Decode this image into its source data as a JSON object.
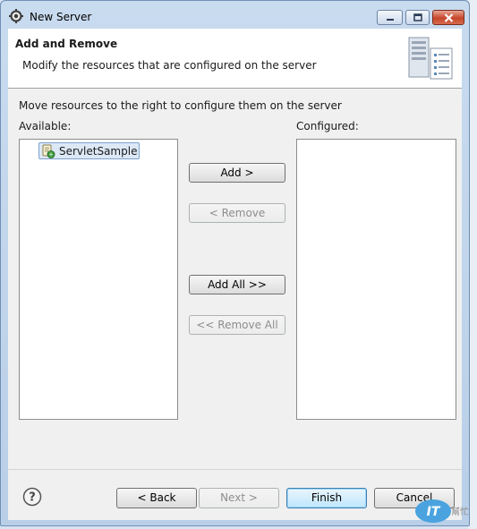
{
  "window": {
    "title": "New Server",
    "icon": "gear-icon"
  },
  "header": {
    "title": "Add and Remove",
    "description": "Modify the resources that are configured on the server",
    "image": "server-list-icon"
  },
  "main": {
    "instructions": "Move resources to the right to configure them on the server",
    "available_label": "Available:",
    "configured_label": "Configured:",
    "available_items": [
      {
        "label": "ServletSample",
        "icon": "web-project-icon",
        "selected": true
      }
    ],
    "configured_items": [],
    "buttons": {
      "add": "Add >",
      "remove": "< Remove",
      "add_all": "Add All >>",
      "remove_all": "<< Remove All"
    }
  },
  "footer": {
    "help_icon": "help-icon",
    "back": "< Back",
    "next": "Next >",
    "finish": "Finish",
    "cancel": "Cancel"
  },
  "watermark": {
    "logo_text": "IT",
    "text": "幫忙"
  },
  "colors": {
    "frame": "#b9cfe8",
    "close_button": "#c5462b",
    "selection": "#dde8f6",
    "default_button": "#bee6fd"
  }
}
